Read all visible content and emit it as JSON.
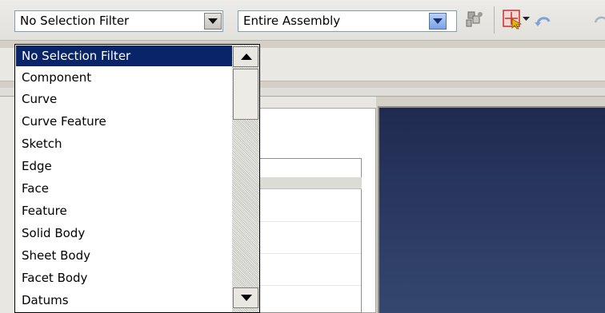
{
  "toolbar": {
    "selection_filter": {
      "value": "No Selection Filter"
    },
    "selection_scope": {
      "value": "Entire Assembly"
    }
  },
  "dropdown": {
    "options": [
      "No Selection Filter",
      "Component",
      "Curve",
      "Curve Feature",
      "Sketch",
      "Edge",
      "Face",
      "Feature",
      "Solid Body",
      "Sheet Body",
      "Facet Body",
      "Datums"
    ],
    "selected_index": 0
  },
  "colors": {
    "selection_highlight": "#0a246a",
    "viewport_bg": "#2c3a63",
    "combo_border": "#7f9db9"
  },
  "icons": [
    "chevron-down-icon",
    "part-navigator-icon",
    "snap-point-icon",
    "undo-arrow-icon",
    "scroll-up-arrow-icon",
    "scroll-down-arrow-icon"
  ]
}
